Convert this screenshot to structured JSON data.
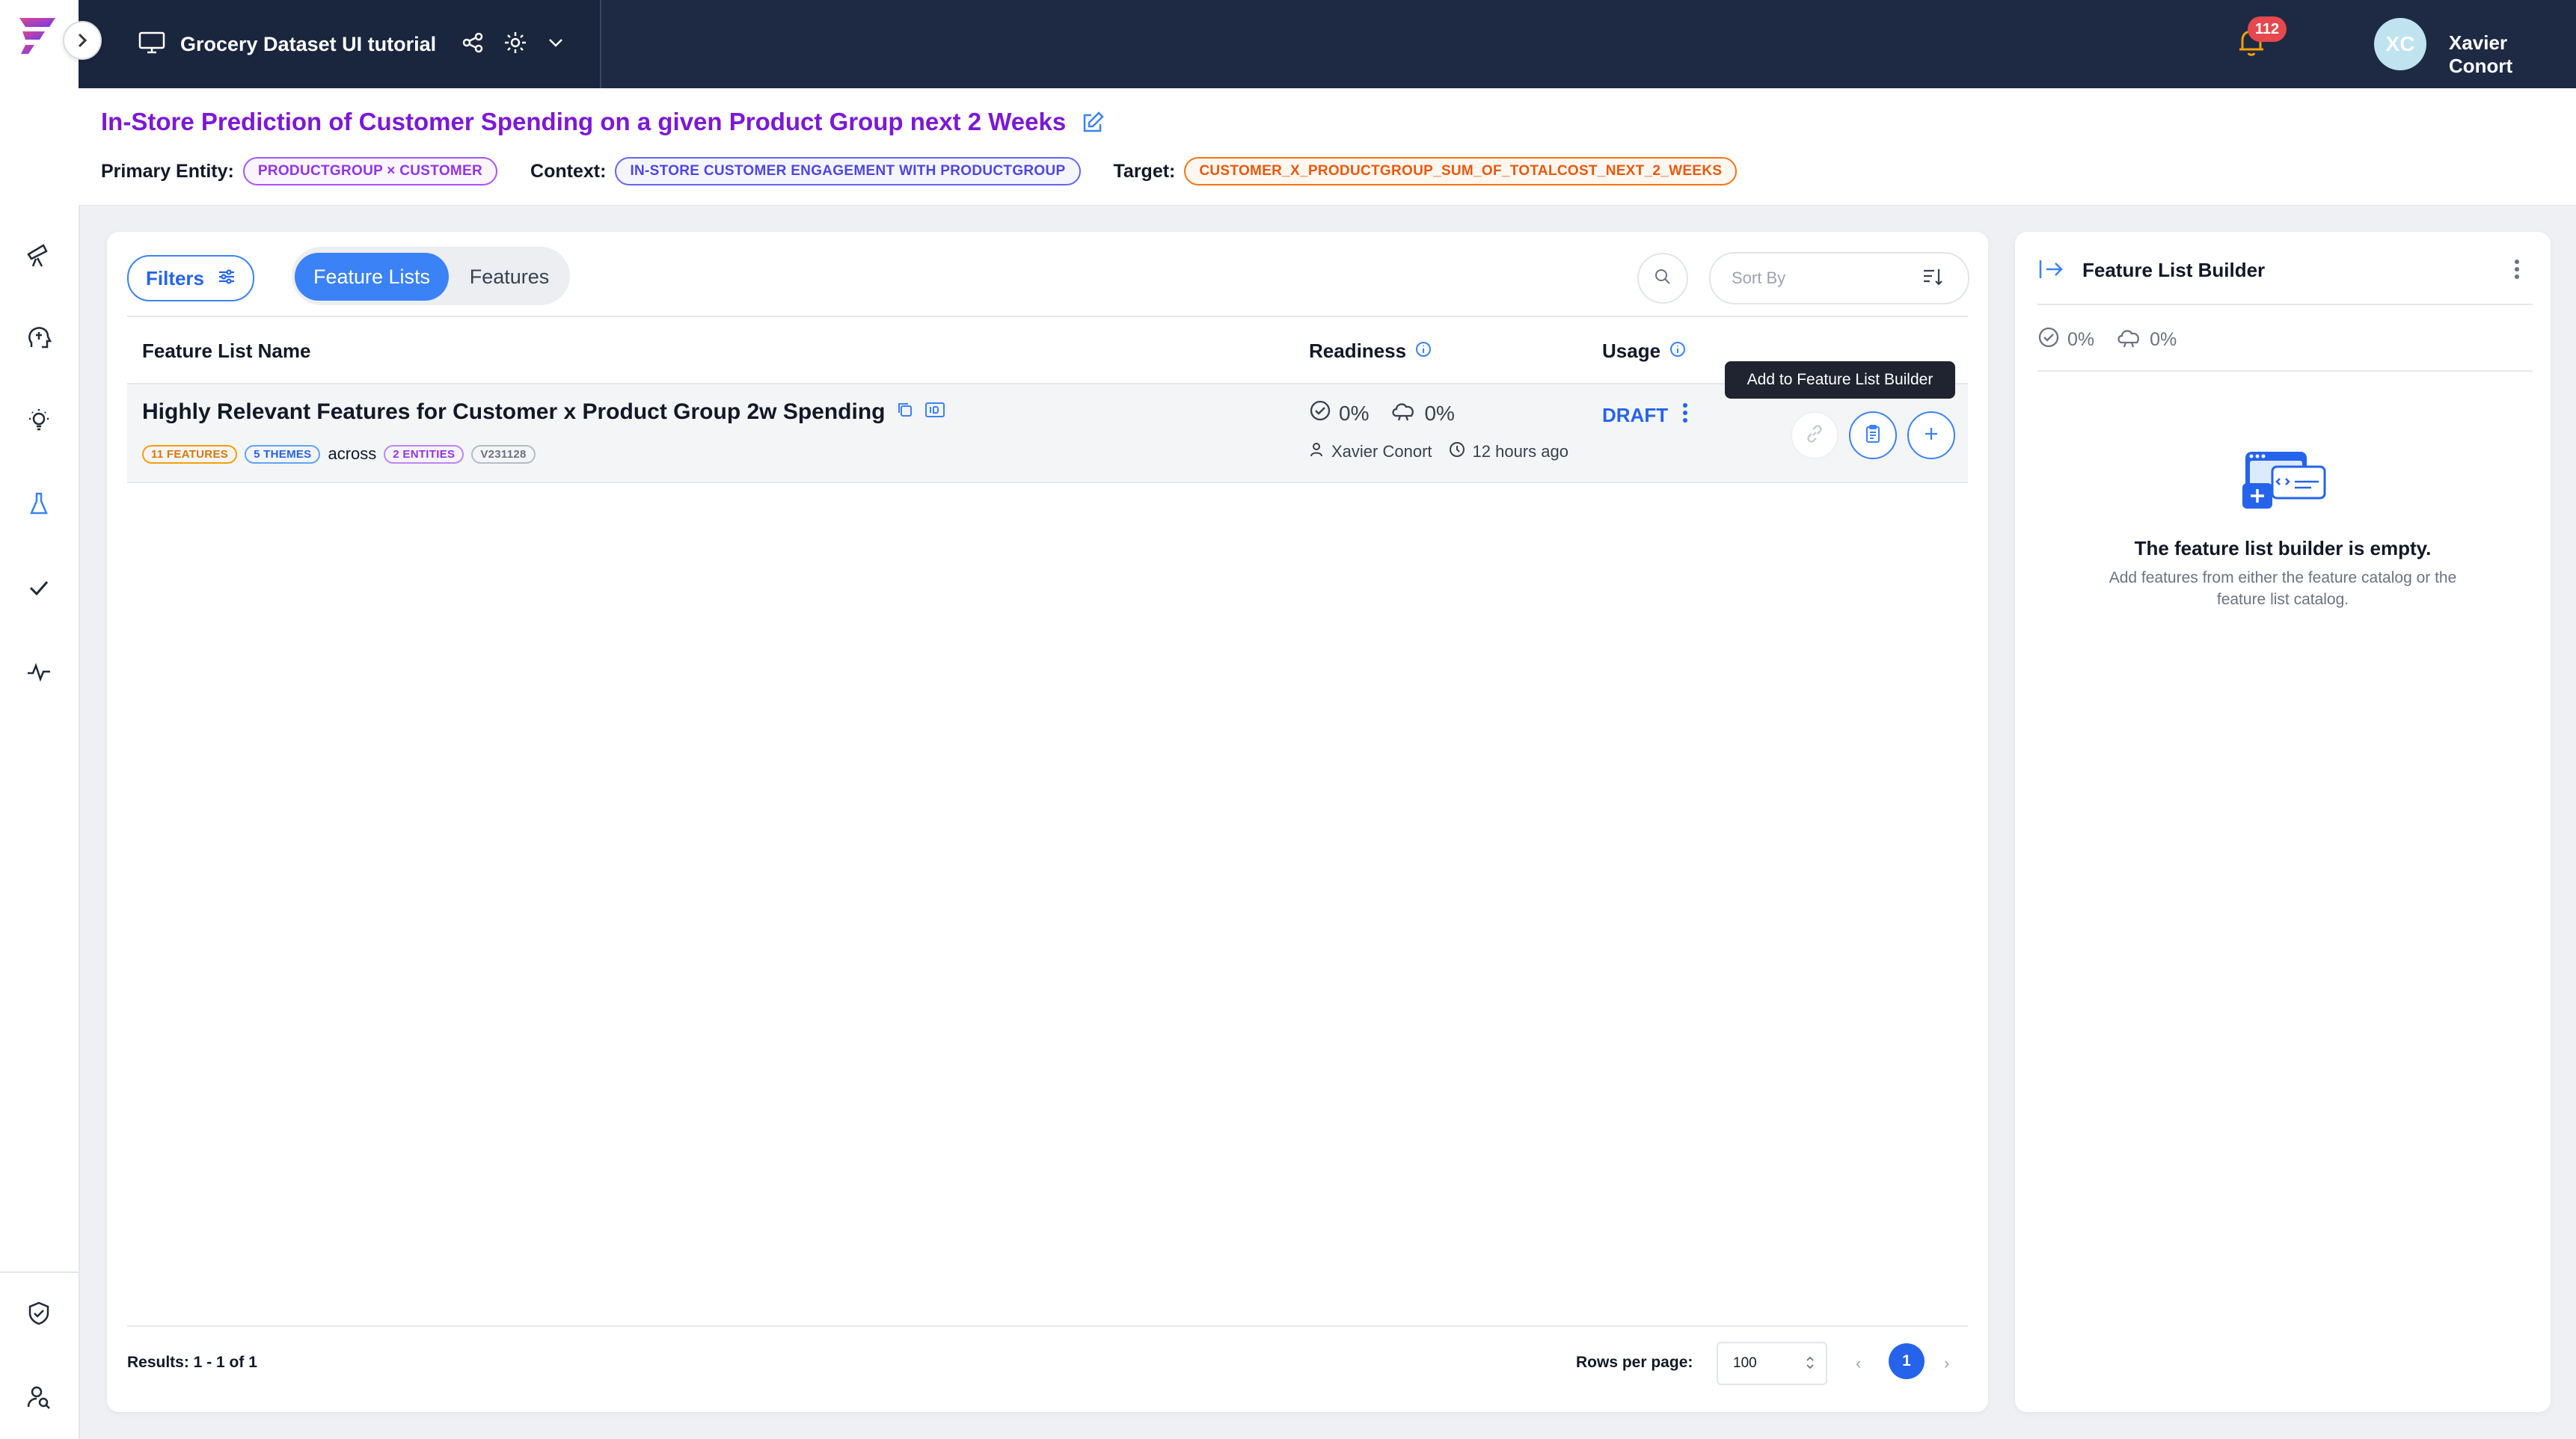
{
  "topbar": {
    "project_name": "Grocery Dataset UI tutorial",
    "notification_count": "112",
    "user_initials": "XC",
    "user_name": "Xavier Conort"
  },
  "context": {
    "use_case_title": "In-Store Prediction of Customer Spending on a given Product Group next 2 Weeks",
    "primary_entity_label": "Primary Entity:",
    "primary_entity_value": "PRODUCTGROUP × CUSTOMER",
    "context_label": "Context:",
    "context_value": "IN-STORE CUSTOMER ENGAGEMENT WITH PRODUCTGROUP",
    "target_label": "Target:",
    "target_value": "CUSTOMER_X_PRODUCTGROUP_SUM_OF_TOTALCOST_NEXT_2_WEEKS"
  },
  "toolbar": {
    "filters_label": "Filters",
    "tabs": [
      {
        "label": "Feature Lists",
        "active": true
      },
      {
        "label": "Features",
        "active": false
      }
    ],
    "sort_placeholder": "Sort By"
  },
  "table": {
    "headers": {
      "name": "Feature List Name",
      "readiness": "Readiness",
      "usage": "Usage"
    },
    "rows": [
      {
        "name": "Highly Relevant Features for Customer x Product Group 2w Spending",
        "badges": {
          "features": "11 FEATURES",
          "themes": "5 THEMES",
          "across": "across",
          "entities": "2 ENTITIES",
          "version": "V231128"
        },
        "readiness_pct": "0%",
        "online_pct": "0%",
        "owner": "Xavier Conort",
        "updated": "12 hours ago",
        "usage": "DRAFT"
      }
    ],
    "tooltip": "Add to Feature List Builder"
  },
  "footer": {
    "results": "Results: 1 - 1 of 1",
    "rows_per_page_label": "Rows per page:",
    "rows_per_page_value": "100",
    "current_page": "1"
  },
  "builder": {
    "title": "Feature List Builder",
    "readiness_pct": "0%",
    "online_pct": "0%",
    "empty_title": "The feature list builder is empty.",
    "empty_desc": "Add features from either the feature catalog or the feature list catalog."
  },
  "colors": {
    "topbar": "#1e2a44",
    "accent": "#3b82f6",
    "title_purple": "#7c18d6",
    "badge_red": "#e5484d"
  }
}
